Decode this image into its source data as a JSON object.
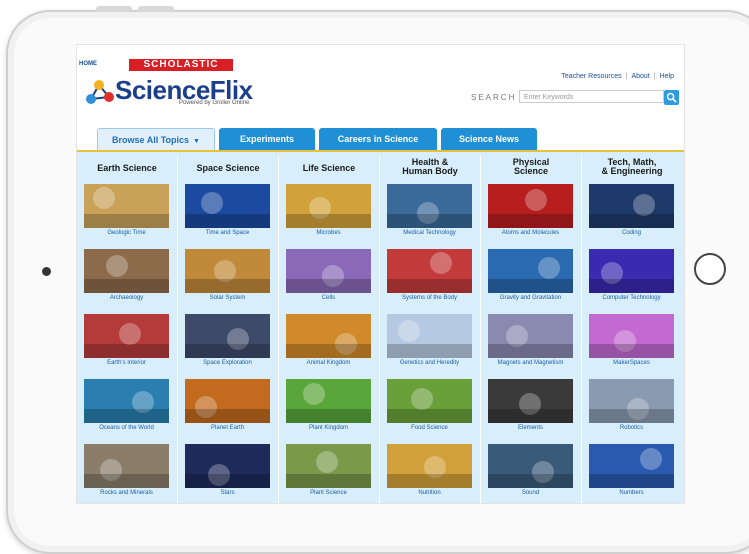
{
  "site": {
    "home_link": "HOME",
    "brand_badge": "SCHOLASTIC",
    "logo_text": "ScienceFlix",
    "logo_sub": "Powered by Grolier Online"
  },
  "top_links": [
    "Teacher Resources",
    "About",
    "Help"
  ],
  "search": {
    "label": "SEARCH",
    "placeholder": "Enter Keywords"
  },
  "tabs": [
    {
      "label": "Browse All Topics",
      "active": true
    },
    {
      "label": "Experiments",
      "active": false
    },
    {
      "label": "Careers in Science",
      "active": false
    },
    {
      "label": "Science News",
      "active": false
    }
  ],
  "columns": [
    {
      "heading": [
        "Earth Science"
      ],
      "topics": [
        "Geologic Time",
        "Archaeology",
        "Earth's Interior",
        "Oceans of the World",
        "Rocks and Minerals"
      ]
    },
    {
      "heading": [
        "Space Science"
      ],
      "topics": [
        "Time and Space",
        "Solar System",
        "Space Exploration",
        "Planet Earth",
        "Stars"
      ]
    },
    {
      "heading": [
        "Life Science"
      ],
      "topics": [
        "Microbes",
        "Cells",
        "Animal Kingdom",
        "Plant Kingdom",
        "Plant Science"
      ]
    },
    {
      "heading": [
        "Health &",
        "Human Body"
      ],
      "topics": [
        "Medical Technology",
        "Systems of the Body",
        "Genetics and Heredity",
        "Food Science",
        "Nutrition"
      ]
    },
    {
      "heading": [
        "Physical",
        "Science"
      ],
      "topics": [
        "Atoms and Molecules",
        "Gravity and Gravitation",
        "Magnets and Magnetism",
        "Elements",
        "Sound"
      ]
    },
    {
      "heading": [
        "Tech, Math,",
        "& Engineering"
      ],
      "topics": [
        "Coding",
        "Computer Technology",
        "MakerSpaces",
        "Robotics",
        "Numbers"
      ]
    }
  ],
  "thumb_colors": [
    [
      "#c9a25a",
      "#8d6a4a",
      "#b53a3a",
      "#2a7fb0",
      "#8a7d6a"
    ],
    [
      "#1c4aa0",
      "#c08a3a",
      "#3d4a6a",
      "#c26a1e",
      "#1e2a5a"
    ],
    [
      "#d2a23a",
      "#8a6ab8",
      "#d08a2a",
      "#5aa63a",
      "#7a9a4a"
    ],
    [
      "#3a6a9a",
      "#c23a3a",
      "#b6c9e2",
      "#6aa03a",
      "#d2a03a"
    ],
    [
      "#b81e1e",
      "#2a6ab0",
      "#8a8ab0",
      "#3a3a3a",
      "#3a5a7a"
    ],
    [
      "#1e3a6a",
      "#3a2ab0",
      "#c26ad2",
      "#8a9ab0",
      "#2a5ab0"
    ]
  ],
  "colors": {
    "accent": "#1f8fd6",
    "brand_red": "#d91f26",
    "logo_blue": "#1b3f8b",
    "link": "#1a5ea6",
    "grid_bg": "#d8eefb",
    "tab_underline": "#e8c23a"
  }
}
